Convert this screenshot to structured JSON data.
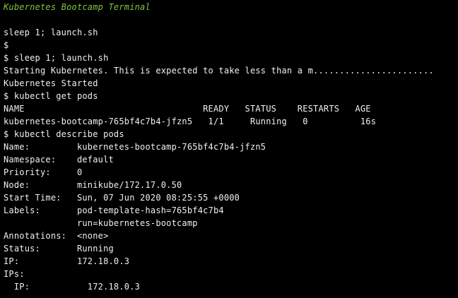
{
  "window": {
    "title": "Kubernetes Bootcamp Terminal"
  },
  "colors": {
    "background": "#000000",
    "text": "#f0f0f0",
    "title": "#7ec63f"
  },
  "terminal": {
    "lines": [
      "sleep 1; launch.sh",
      "$",
      "$ sleep 1; launch.sh",
      "Starting Kubernetes. This is expected to take less than a m.......................",
      "Kubernetes Started",
      "$ kubectl get pods",
      "NAME                                  READY   STATUS    RESTARTS   AGE",
      "kubernetes-bootcamp-765bf4c7b4-jfzn5   1/1     Running   0          16s",
      "$ kubectl describe pods",
      "Name:         kubernetes-bootcamp-765bf4c7b4-jfzn5",
      "Namespace:    default",
      "Priority:     0",
      "Node:         minikube/172.17.0.50",
      "Start Time:   Sun, 07 Jun 2020 08:25:55 +0000",
      "Labels:       pod-template-hash=765bf4c7b4",
      "              run=kubernetes-bootcamp",
      "Annotations:  <none>",
      "Status:       Running",
      "IP:           172.18.0.3",
      "IPs:",
      "  IP:           172.18.0.3"
    ]
  }
}
